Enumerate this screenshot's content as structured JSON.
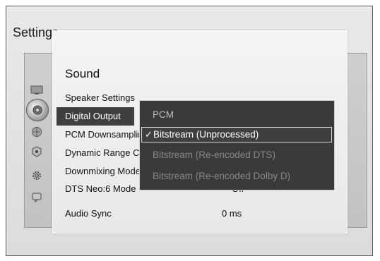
{
  "background_title": "Settings",
  "section": {
    "title": "Sound",
    "items": [
      {
        "label": "Speaker Settings",
        "value": ""
      },
      {
        "label": "Digital Output",
        "value": ""
      },
      {
        "label": "PCM Downsampling",
        "value": ""
      },
      {
        "label": "Dynamic Range Control",
        "value": ""
      },
      {
        "label": "Downmixing Mode",
        "value": ""
      },
      {
        "label": "DTS Neo:6 Mode",
        "value": "Off"
      },
      {
        "label": "Audio Sync",
        "value": "0 ms"
      }
    ]
  },
  "dropdown": {
    "options": [
      "PCM",
      "Bitstream (Unprocessed)",
      "Bitstream (Re-encoded DTS)",
      "Bitstream (Re-encoded Dolby D)"
    ],
    "selected_index": 1,
    "check_glyph": "✓"
  },
  "side_icons": [
    "display-icon",
    "sound-icon",
    "network-icon",
    "system-icon",
    "settings-gear-icon",
    "support-icon"
  ]
}
